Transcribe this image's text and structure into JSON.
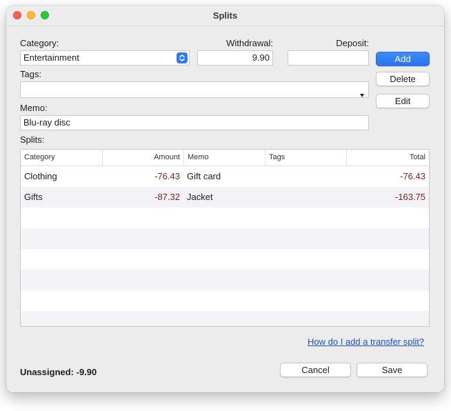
{
  "window": {
    "title": "Splits"
  },
  "form": {
    "category_label": "Category:",
    "category_value": "Entertainment",
    "withdrawal_label": "Withdrawal:",
    "withdrawal_value": "9.90",
    "deposit_label": "Deposit:",
    "deposit_value": "",
    "tags_label": "Tags:",
    "tags_value": "",
    "memo_label": "Memo:",
    "memo_value": "Blu-ray disc"
  },
  "buttons": {
    "add": "Add",
    "delete": "Delete",
    "edit": "Edit",
    "cancel": "Cancel",
    "save": "Save"
  },
  "splits": {
    "label": "Splits:",
    "columns": [
      "Category",
      "Amount",
      "Memo",
      "Tags",
      "Total"
    ],
    "rows": [
      {
        "category": "Clothing",
        "amount": "-76.43",
        "memo": "Gift card",
        "tags": "",
        "total": "-76.43"
      },
      {
        "category": "Gifts",
        "amount": "-87.32",
        "memo": "Jacket",
        "tags": "",
        "total": "-163.75"
      }
    ]
  },
  "help_link": "How do I add a transfer split?",
  "status": {
    "unassigned": "Unassigned: -9.90"
  },
  "colors": {
    "accent": "#2d78f4",
    "negative": "#8b1a1a",
    "link": "#1a4fd6"
  },
  "icons": {
    "category_select": "chevron-updown-icon",
    "tags_dropdown": "triangle-down-icon"
  }
}
